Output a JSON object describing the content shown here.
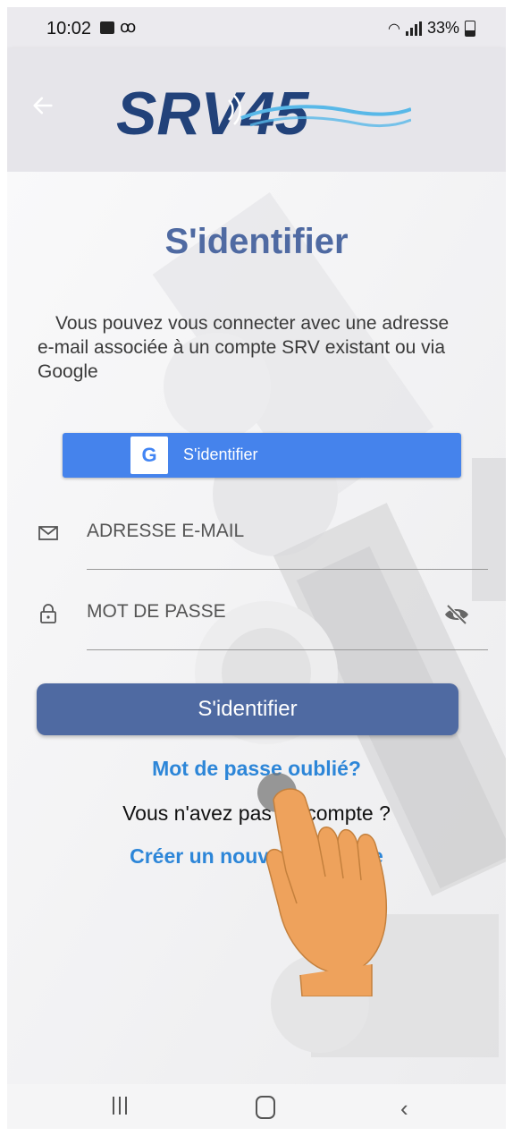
{
  "status_bar": {
    "time": "10:02",
    "voicemail_glyph": "ꝏ",
    "battery": "33%"
  },
  "header": {
    "logo_text": "SRV45"
  },
  "login": {
    "title": "S'identifier",
    "intro": "Vous pouvez vous connecter avec une adresse e-mail associée à un compte SRV existant ou via Google",
    "google_button_label": "S'identifier",
    "google_logo_letter": "G",
    "email_placeholder": "ADRESSE E-MAIL",
    "password_placeholder": "MOT DE PASSE",
    "submit_label": "S'identifier",
    "forgot_password": "Mot de passe oublié?",
    "no_account": "Vous n'avez pas un compte ?",
    "create_account": "Créer un nouveau compte"
  },
  "colors": {
    "primary": "#4f6aa2",
    "google_blue": "#4583ec",
    "link": "#2d86d8"
  }
}
